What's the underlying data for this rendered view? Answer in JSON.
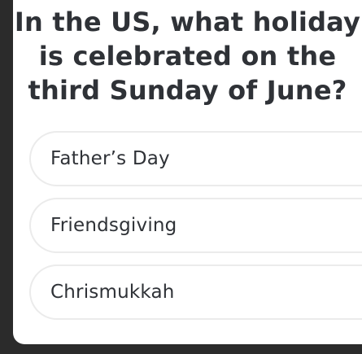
{
  "quiz": {
    "question": "In the US, what holiday is celebrated on the third Sunday of June?",
    "options": [
      {
        "label": "Father’s Day"
      },
      {
        "label": "Friendsgiving"
      },
      {
        "label": "Chrismukkah"
      }
    ]
  },
  "colors": {
    "background": "#2b2b2b",
    "card": "#ffffff",
    "text": "#2f3237",
    "option_border": "#ebebeb"
  }
}
